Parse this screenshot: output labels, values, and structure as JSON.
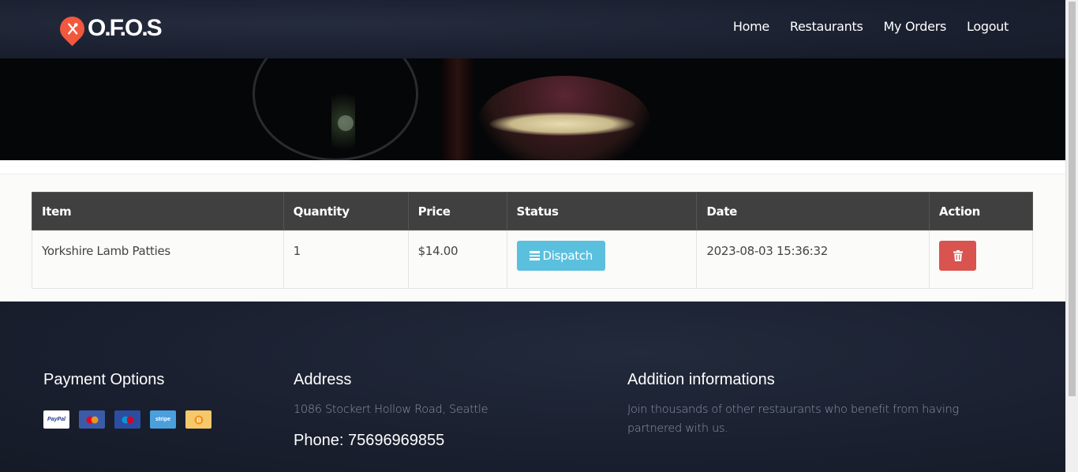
{
  "brand": {
    "name": "O.F.O.S"
  },
  "nav": {
    "items": [
      {
        "label": "Home"
      },
      {
        "label": "Restaurants"
      },
      {
        "label": "My Orders"
      },
      {
        "label": "Logout"
      }
    ]
  },
  "orders": {
    "columns": [
      "Item",
      "Quantity",
      "Price",
      "Status",
      "Date",
      "Action"
    ],
    "rows": [
      {
        "item": "Yorkshire Lamb Patties",
        "quantity": "1",
        "price": "$14.00",
        "status": "Dispatch",
        "date": "2023-08-03 15:36:32",
        "action_icon": "trash-icon"
      }
    ]
  },
  "footer": {
    "payment_title": "Payment Options",
    "payment_methods": [
      {
        "name": "PayPal",
        "icon": "paypal-icon"
      },
      {
        "name": "",
        "icon": "mastercard-icon"
      },
      {
        "name": "",
        "icon": "maestro-icon"
      },
      {
        "name": "stripe",
        "icon": "stripe-icon"
      },
      {
        "name": "",
        "icon": "bitcoin-icon"
      }
    ],
    "address_title": "Address",
    "address": "1086 Stockert Hollow Road, Seattle",
    "phone": "Phone: 75696969855",
    "info_title": "Addition informations",
    "info_text": "Join thousands of other restaurants who benefit from having partnered with us."
  },
  "colors": {
    "accent": "#f2583e",
    "table_header": "#404040",
    "dispatch_button": "#5bc0de",
    "delete_button": "#d9534f",
    "dark_bg": "#1b2130"
  }
}
